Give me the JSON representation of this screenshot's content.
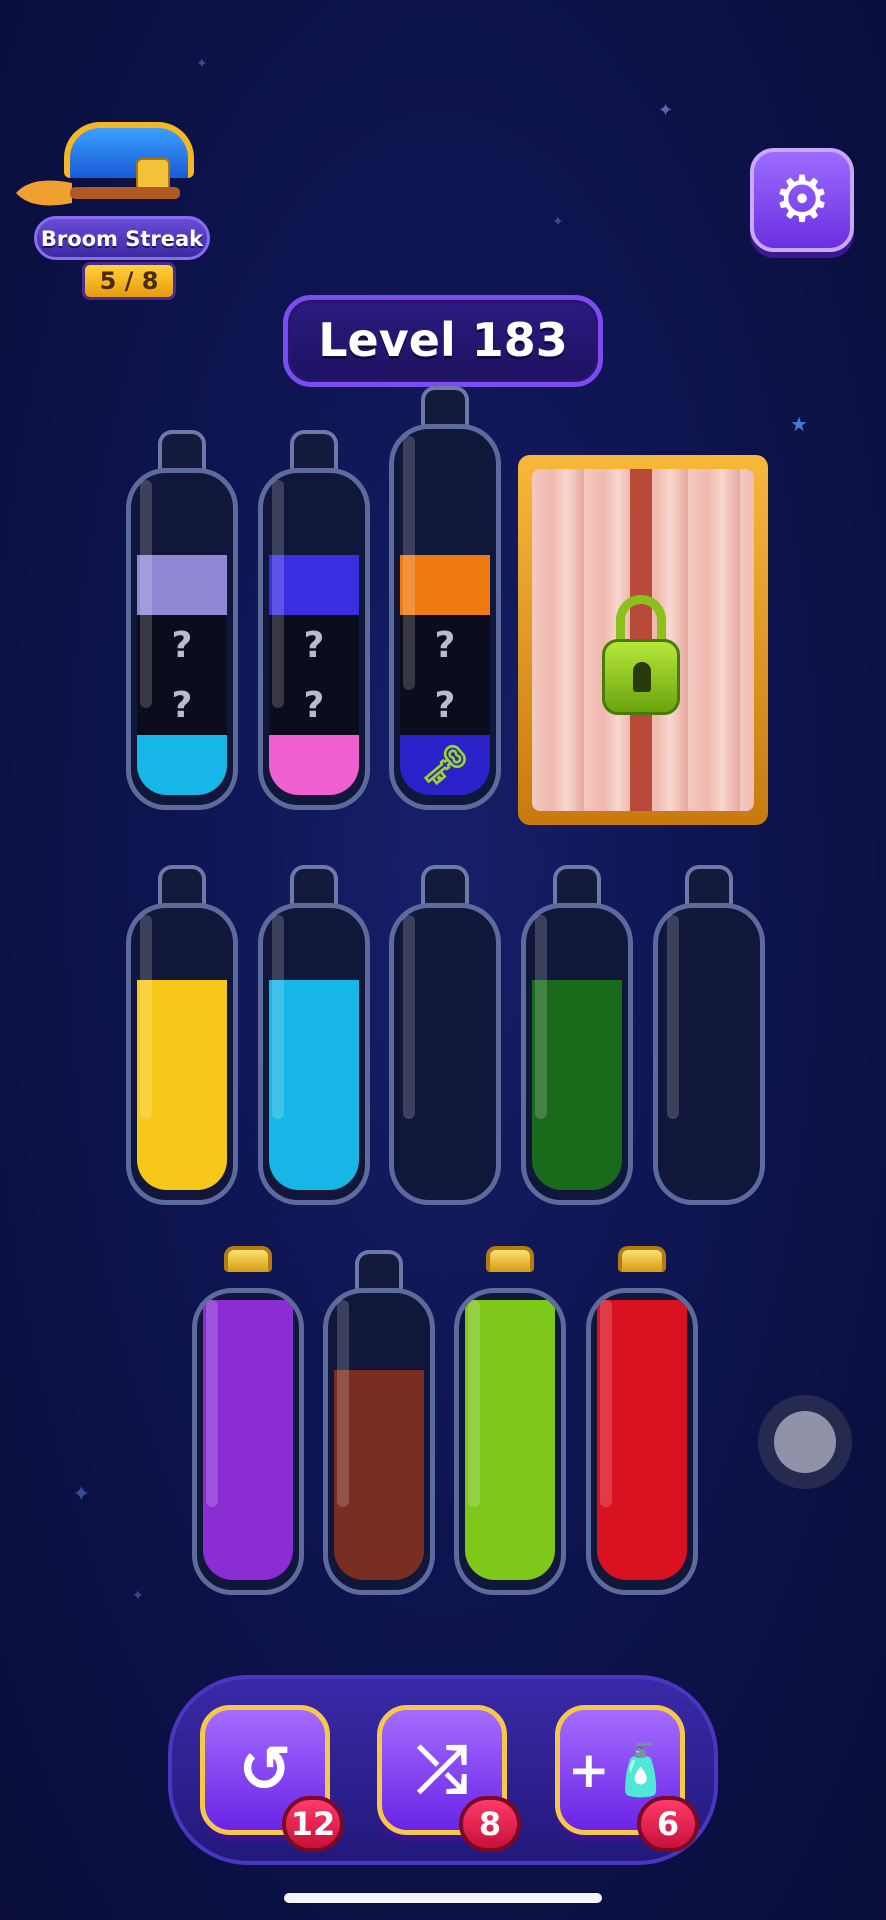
{
  "broom_streak": {
    "label": "Broom Streak",
    "progress": "5 / 8"
  },
  "level": {
    "label": "Level 183"
  },
  "colors": {
    "lavender": "#8f88d4",
    "blue": "#3a2ee0",
    "orange": "#f07a12",
    "cyan": "#16b6e6",
    "pink": "#f060d0",
    "dark_blue": "#2a22c8",
    "yellow": "#f7c81a",
    "empty": "#11173a",
    "green": "#1a6a1c",
    "purple": "#8a2ed4",
    "brown": "#7a2e22",
    "lime": "#7ec81a",
    "red": "#d81220",
    "hidden": "#0b0d1c"
  },
  "rows": [
    [
      {
        "id": "b1",
        "segments": [
          "cyan",
          "hidden:?",
          "hidden:?",
          "lavender"
        ]
      },
      {
        "id": "b2",
        "segments": [
          "pink",
          "hidden:?",
          "hidden:?",
          "blue"
        ]
      },
      {
        "id": "b3",
        "segments": [
          "dark_blue:key",
          "hidden:?",
          "hidden:?",
          "orange"
        ]
      }
    ],
    [
      {
        "id": "b4",
        "segments": [
          "yellow",
          "yellow",
          "yellow"
        ]
      },
      {
        "id": "b5",
        "segments": [
          "cyan",
          "cyan",
          "cyan"
        ]
      },
      {
        "id": "b6",
        "segments": []
      },
      {
        "id": "b7",
        "segments": [
          "green",
          "green",
          "green"
        ]
      },
      {
        "id": "b8",
        "segments": []
      }
    ],
    [
      {
        "id": "b9",
        "segments": [
          "purple",
          "purple",
          "purple",
          "purple"
        ],
        "corked": true
      },
      {
        "id": "b10",
        "segments": [
          "brown",
          "brown",
          "brown"
        ]
      },
      {
        "id": "b11",
        "segments": [
          "lime",
          "lime",
          "lime",
          "lime"
        ],
        "corked": true
      },
      {
        "id": "b12",
        "segments": [
          "red",
          "red",
          "red",
          "red"
        ],
        "corked": true
      }
    ]
  ],
  "boosters": {
    "undo": {
      "icon": "undo-icon",
      "count": "12"
    },
    "shuffle": {
      "icon": "shuffle-icon",
      "count": "8"
    },
    "add_bottle": {
      "icon": "add-bottle-icon",
      "count": "6"
    }
  }
}
